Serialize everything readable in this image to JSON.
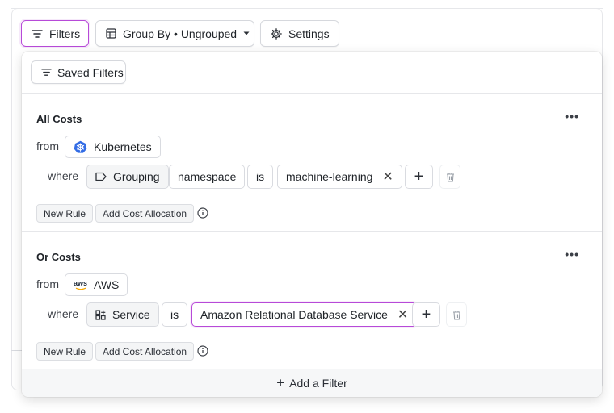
{
  "toolbar": {
    "filters_label": "Filters",
    "group_by_label": "Group By • Ungrouped",
    "settings_label": "Settings"
  },
  "panel": {
    "saved_filters_label": "Saved Filters",
    "filters": [
      {
        "title": "All Costs",
        "from_label": "from",
        "source": "Kubernetes",
        "where_label": "where",
        "field_type": "Grouping",
        "field": "namespace",
        "operator": "is",
        "value": "machine-learning",
        "new_rule_label": "New Rule",
        "add_allocation_label": "Add Cost Allocation"
      },
      {
        "title": "Or Costs",
        "from_label": "from",
        "source": "AWS",
        "source_logo_text": "aws",
        "where_label": "where",
        "field": "Service",
        "operator": "is",
        "value": "Amazon Relational Database Service",
        "new_rule_label": "New Rule",
        "add_allocation_label": "Add Cost Allocation"
      }
    ],
    "add_filter_label": "Add a Filter"
  },
  "icons": {
    "filter": "filter-lines-icon",
    "group": "table-grid-icon",
    "settings": "gear-icon",
    "kubernetes": "kubernetes-icon",
    "aws": "aws-logo-icon",
    "tag": "tag-icon",
    "service": "grid-plus-icon",
    "trash": "trash-icon",
    "info": "info-icon",
    "more": "more-horizontal-icon"
  },
  "colors": {
    "accent": "#b74ad8",
    "kubernetes_blue": "#326ce5",
    "aws_orange": "#f7a800"
  }
}
